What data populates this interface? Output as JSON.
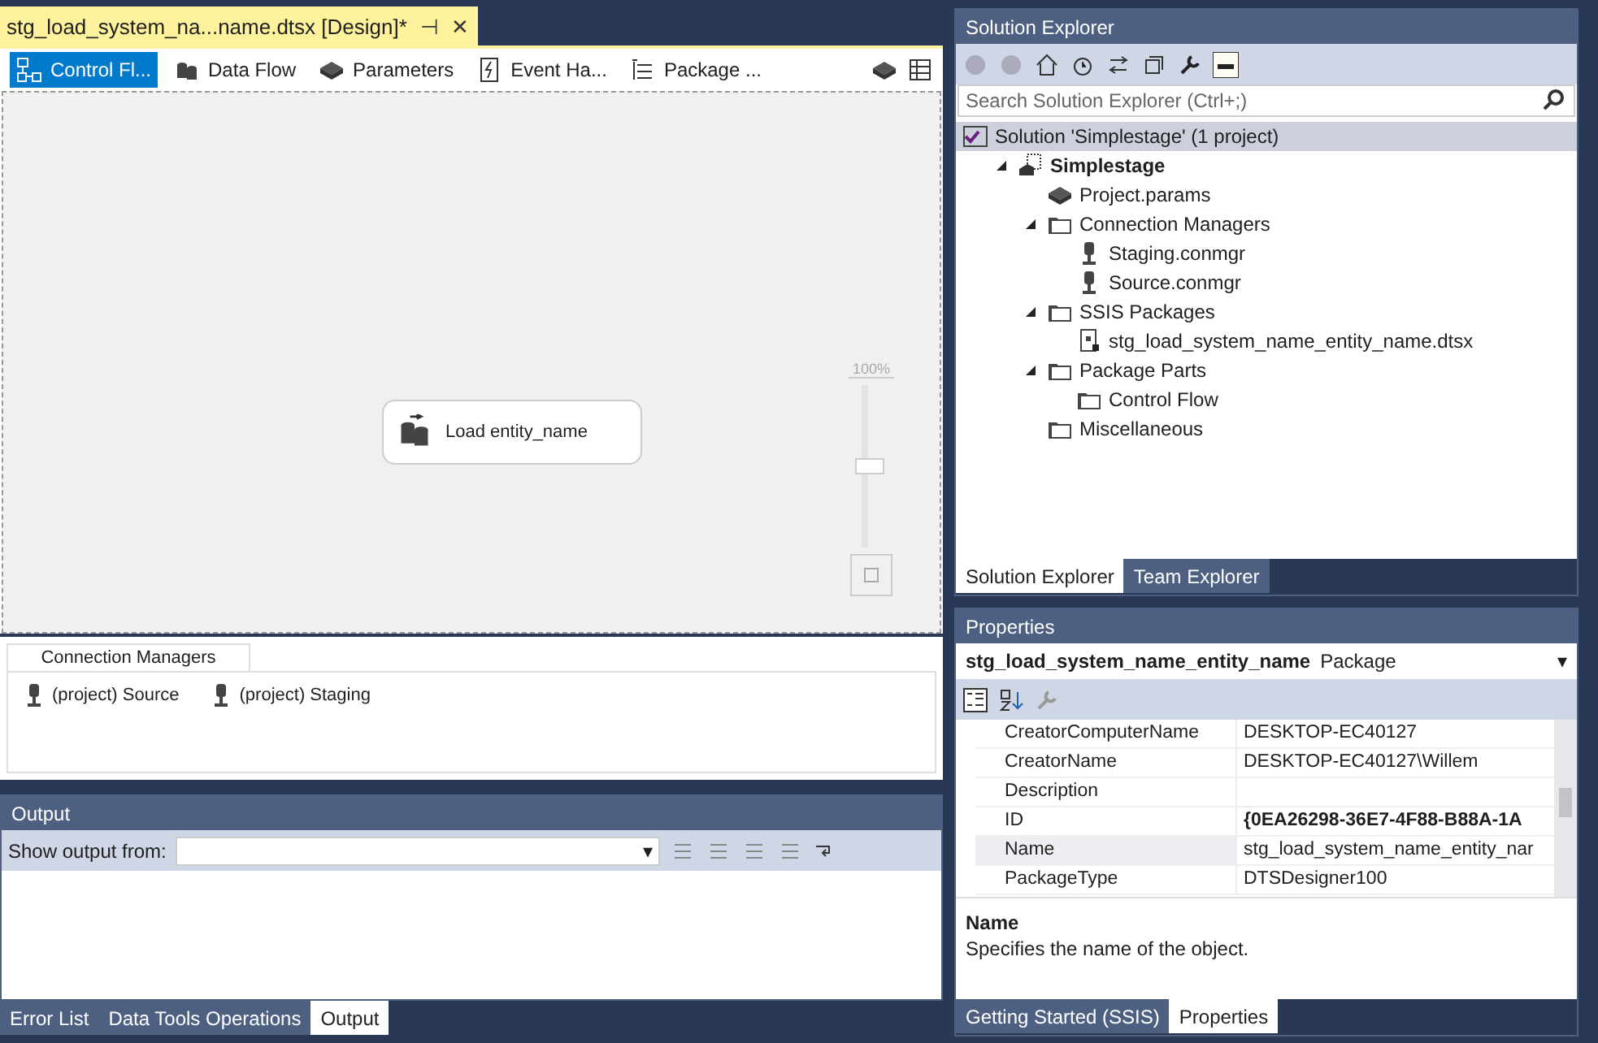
{
  "document_tab": {
    "title": "stg_load_system_na...name.dtsx [Design]*",
    "pin": "⊣",
    "close": "✕"
  },
  "designer_tabs": [
    {
      "label": "Control Fl...",
      "kind": "control",
      "selected": true
    },
    {
      "label": "Data Flow",
      "kind": "dataflow",
      "selected": false
    },
    {
      "label": "Parameters",
      "kind": "params",
      "selected": false
    },
    {
      "label": "Event Ha...",
      "kind": "event",
      "selected": false
    },
    {
      "label": "Package ...",
      "kind": "explorer",
      "selected": false
    }
  ],
  "canvas": {
    "task": {
      "label": "Load entity_name"
    },
    "zoom": {
      "label": "100%",
      "level": 0.5
    }
  },
  "connection_managers": {
    "title": "Connection Managers",
    "items": [
      "(project) Source",
      "(project) Staging"
    ]
  },
  "output": {
    "title": "Output",
    "show_from_label": "Show output from:",
    "dropdown_arrow": "▾"
  },
  "bottom_tabs": [
    {
      "label": "Error List",
      "selected": false
    },
    {
      "label": "Data Tools Operations",
      "selected": false
    },
    {
      "label": "Output",
      "selected": true
    }
  ],
  "solution_explorer": {
    "title": "Solution Explorer",
    "search": {
      "placeholder": "Search Solution Explorer (Ctrl+;)"
    },
    "tree": [
      {
        "label": "Solution 'Simplestage' (1 project)",
        "kind": "solution",
        "selected": true,
        "children": [
          {
            "label": "Simplestage",
            "kind": "project",
            "selected": false,
            "expanded": true,
            "children": [
              {
                "label": "Project.params",
                "kind": "params",
                "selected": false
              },
              {
                "label": "Connection Managers",
                "kind": "folder",
                "selected": false,
                "expanded": true,
                "children": [
                  {
                    "label": "Staging.conmgr",
                    "kind": "connection",
                    "selected": false
                  },
                  {
                    "label": "Source.conmgr",
                    "kind": "connection",
                    "selected": false
                  }
                ]
              },
              {
                "label": "SSIS Packages",
                "kind": "folder",
                "selected": false,
                "expanded": true,
                "children": [
                  {
                    "label": "stg_load_system_name_entity_name.dtsx",
                    "kind": "package",
                    "selected": false
                  }
                ]
              },
              {
                "label": "Package Parts",
                "kind": "folder",
                "selected": false,
                "expanded": true,
                "children": [
                  {
                    "label": "Control Flow",
                    "kind": "folder",
                    "selected": false
                  }
                ]
              },
              {
                "label": "Miscellaneous",
                "kind": "folder",
                "selected": false
              }
            ]
          }
        ]
      }
    ],
    "tabs": [
      {
        "label": "Solution Explorer",
        "selected": true
      },
      {
        "label": "Team Explorer",
        "selected": false
      }
    ]
  },
  "properties": {
    "title": "Properties",
    "object_name": "stg_load_system_name_entity_name",
    "object_type": "Package",
    "dropdown_arrow": "▾",
    "rows": [
      {
        "name": "CreatorComputerName",
        "value": "DESKTOP-EC40127",
        "modified": false,
        "selected": false
      },
      {
        "name": "CreatorName",
        "value": "DESKTOP-EC40127\\Willem",
        "modified": false,
        "selected": false
      },
      {
        "name": "Description",
        "value": "",
        "selected": false
      },
      {
        "name": "ID",
        "value": "{0EA26298-36E7-4F88-B88A-1A",
        "modified": true,
        "selected": false
      },
      {
        "name": "Name",
        "value": "stg_load_system_name_entity_nar",
        "modified": false,
        "selected": true
      },
      {
        "name": "PackageType",
        "value": "DTSDesigner100",
        "modified": false,
        "selected": false
      }
    ],
    "description_title": "Name",
    "description": "Specifies the name of the object.",
    "tabs": [
      {
        "label": "Getting Started (SSIS)",
        "selected": false
      },
      {
        "label": "Properties",
        "selected": true
      }
    ]
  }
}
